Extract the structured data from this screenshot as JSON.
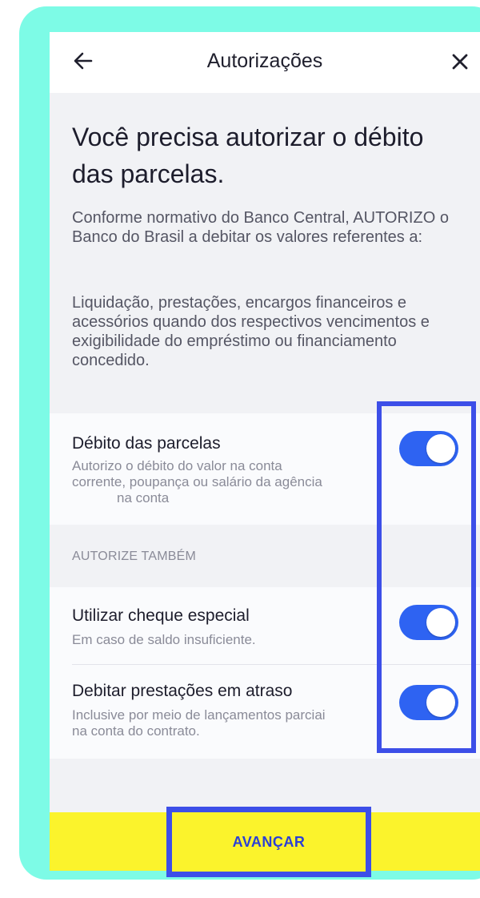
{
  "header": {
    "title": "Autorizações",
    "back_icon": "arrow-left-icon",
    "close_icon": "close-icon"
  },
  "intro": {
    "heading": "Você precisa autorizar o débito das parcelas.",
    "paragraph1": "Conforme normativo do Banco Central, AUTORIZO o Banco do Brasil a debitar os valores referentes a:",
    "paragraph2": "Liquidação, prestações, encargos financeiros e acessórios quando dos respectivos vencimentos e exigibilidade do empréstimo ou financiamento concedido."
  },
  "debito": {
    "title": "Débito das parcelas",
    "description_line1": "Autorizo o débito do valor na conta",
    "description_line2": "corrente, poupança ou salário da agência",
    "description_line3": "na conta",
    "enabled": true
  },
  "section_label": "AUTORIZE TAMBÉM",
  "extras": [
    {
      "title": "Utilizar cheque especial",
      "description": "Em caso de saldo insuficiente.",
      "enabled": true
    },
    {
      "title": "Debitar prestações em atraso",
      "description_line1": "Inclusive por meio de lançamentos parciai",
      "description_line2": "na conta  do contrato.",
      "enabled": true
    }
  ],
  "footer": {
    "advance_label": "AVANÇAR"
  },
  "colors": {
    "frame": "#7dfbe6",
    "toggle_on": "#2e63f2",
    "footer": "#fbf32c",
    "highlight": "#3d4fe8"
  }
}
